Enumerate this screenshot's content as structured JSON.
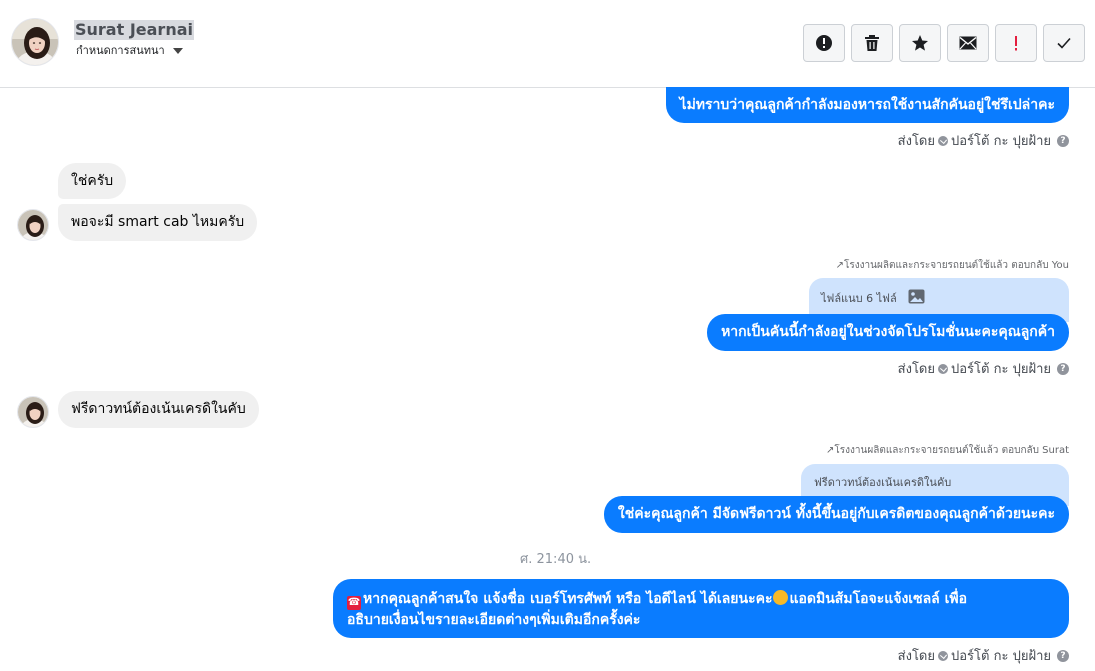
{
  "contact": {
    "name": "Surat Jearnai",
    "assign_label": "กำหนดการสนทนา"
  },
  "toolbar": {
    "buttons": [
      {
        "name": "report-icon",
        "label": "Report"
      },
      {
        "name": "trash-icon",
        "label": "Delete"
      },
      {
        "name": "star-icon",
        "label": "Star"
      },
      {
        "name": "mail-icon",
        "label": "Mark unread"
      },
      {
        "name": "exclamation-icon",
        "label": "Important"
      },
      {
        "name": "check-icon",
        "label": "Done"
      }
    ],
    "exclamation_color": "#e41e3f"
  },
  "messages": {
    "m1": "ไม่ทราบว่าคุณลูกค้ากำลังมองหารถใช้งานสักคันอยู่ใช่รึเปล่าคะ",
    "m1_meta": "ส่งโดย",
    "sender": "ปอร์โต้ กะ ปุยฝ้าย",
    "m2": "ใช่ครับ",
    "m3": "พอจะมี smart cab ไหมครับ",
    "reply1_note": "โรงงานผลิตและกระจายรถยนต์ใช้แล้ว ตอบกลับ You",
    "reply1_quote": "ไฟล์แนบ 6 ไฟล์",
    "m4": "หากเป็นคันนี้กำลังอยู่ในช่วงจัดโปรโมชั่นนะคะคุณลูกค้า",
    "m5": "ฟรีดาวทน์ต้องเน้นเครดิในคับ",
    "reply2_note": "โรงงานผลิตและกระจายรถยนต์ใช้แล้ว ตอบกลับ Surat",
    "reply2_quote": "ฟรีดาวทน์ต้องเน้นเครดิในคับ",
    "m6": "ใช่ค่ะคุณลูกค้า มีจัดฟรีดาวน์ ทั้งนี้ขึ้นอยู่กับเครดิตของคุณลูกค้าด้วยนะคะ",
    "time": "ศ. 21:40 น.",
    "m7_line1": "หากคุณลูกค้าสนใจ แจ้งชื่อ เบอร์โทรศัพท์ หรือ ไอดีไลน์  ได้เลยนะคะ",
    "m7_line1b": "แอดมินส้มโอจะแจ้งเซลล์   เพื่อ",
    "m7_line2": "อธิบายเงื่อนไขรายละเอียดต่างๆเพิ่มเติมอีกครั้งค่ะ"
  }
}
